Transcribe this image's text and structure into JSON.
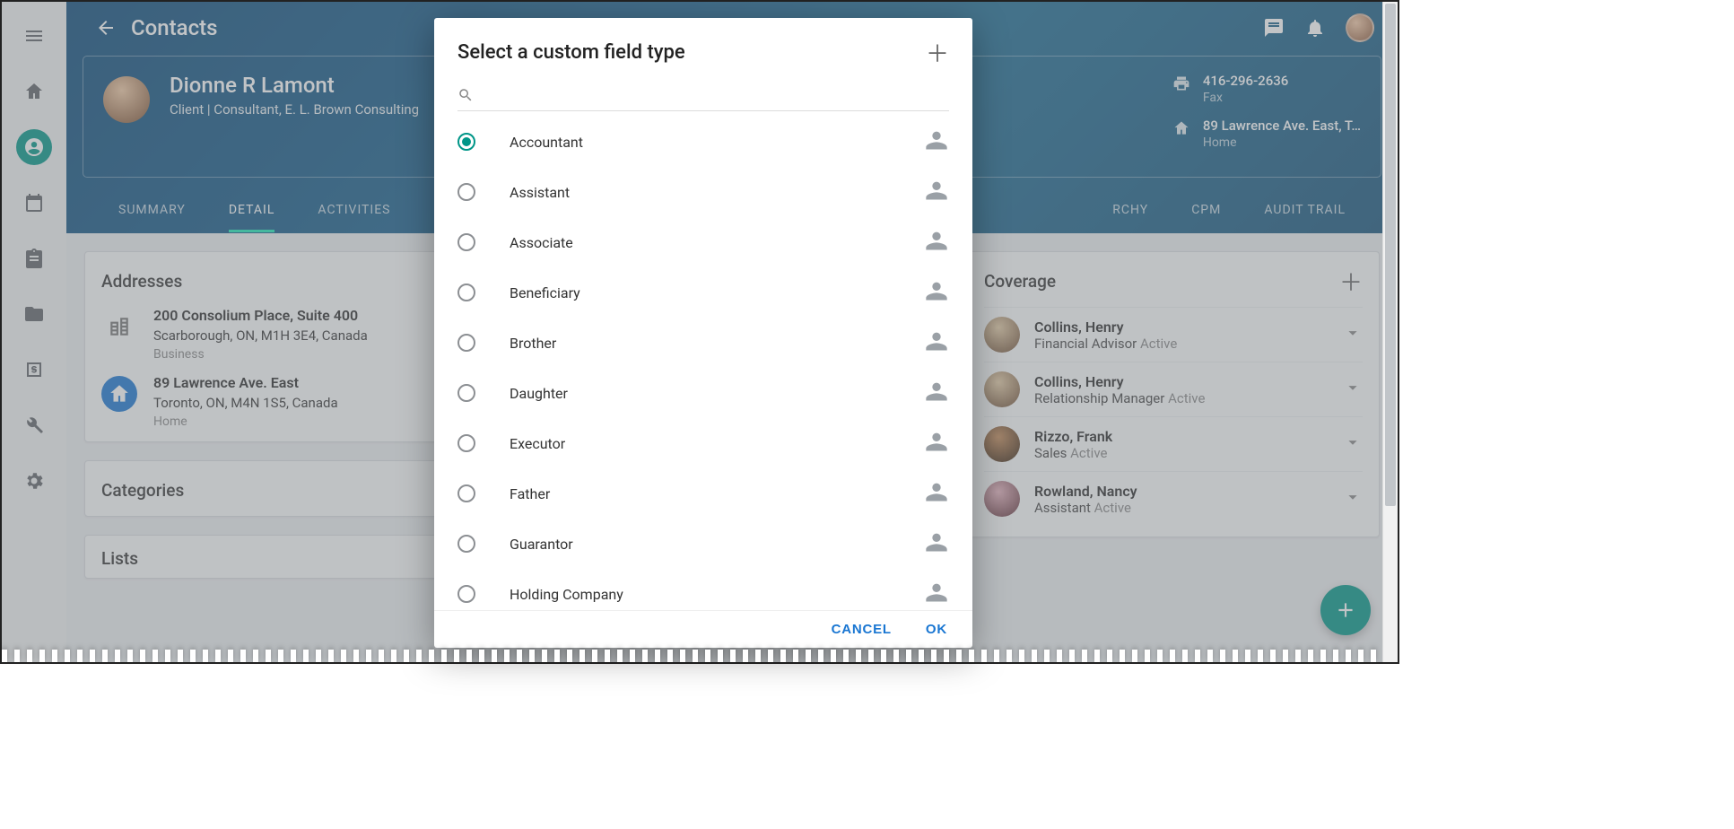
{
  "page_title": "Contacts",
  "contact": {
    "name": "Dionne R Lamont",
    "subtitle": "Client | Consultant, E. L. Brown Consulting",
    "fax_number": "416-296-2636",
    "fax_label": "Fax",
    "home_address": "89 Lawrence Ave. East, T…",
    "home_label": "Home"
  },
  "tabs": [
    "SUMMARY",
    "DETAIL",
    "ACTIVITIES",
    "RCHY",
    "CPM",
    "AUDIT TRAIL"
  ],
  "tabs_active_index": 1,
  "cards": {
    "addresses": {
      "title": "Addresses",
      "items": [
        {
          "line1": "200 Consolium Place, Suite 400",
          "line2": "Scarborough, ON, M1H 3E4, Canada",
          "type": "Business",
          "icon": "building"
        },
        {
          "line1": "89 Lawrence Ave. East",
          "line2": "Toronto, ON, M4N 1S5, Canada",
          "type": "Home",
          "icon": "home"
        }
      ]
    },
    "categories": {
      "title": "Categories"
    },
    "lists": {
      "title": "Lists"
    },
    "coverage": {
      "title": "Coverage",
      "items": [
        {
          "name": "Collins, Henry",
          "role": "Financial Advisor",
          "status": "Active"
        },
        {
          "name": "Collins, Henry",
          "role": "Relationship Manager",
          "status": "Active"
        },
        {
          "name": "Rizzo, Frank",
          "role": "Sales",
          "status": "Active"
        },
        {
          "name": "Rowland, Nancy",
          "role": "Assistant",
          "status": "Active"
        }
      ]
    }
  },
  "dialog": {
    "title": "Select a custom field type",
    "search_placeholder": "",
    "cancel": "CANCEL",
    "ok": "OK",
    "selected_index": 0,
    "options": [
      "Accountant",
      "Assistant",
      "Associate",
      "Beneficiary",
      "Brother",
      "Daughter",
      "Executor",
      "Father",
      "Guarantor",
      "Holding Company"
    ]
  }
}
